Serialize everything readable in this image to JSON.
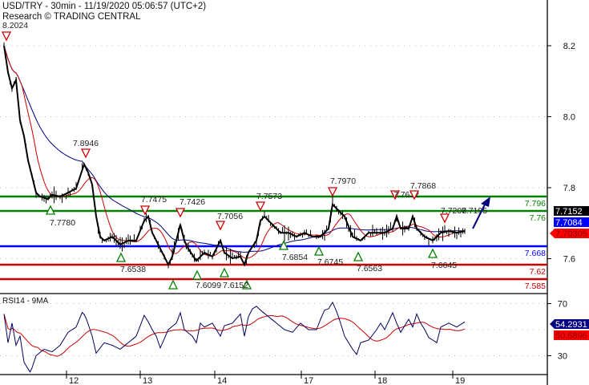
{
  "header": {
    "title": "USD/TRY - 30min - 11/19/2020 05:06:57 (UTC+2)",
    "subtitle": "Research © TRADING CENTRAL"
  },
  "rsi_panel": {
    "label": "RSI14 - 9MA"
  },
  "colors": {
    "price": "#000000",
    "ma_fast": "#cc0000",
    "ma_slow": "#000080",
    "resistance": "#008000",
    "pivot": "#0000ff",
    "support": "#cc0000",
    "rsi": "#000060",
    "rsi_ma": "#cc0000"
  },
  "chart_data": {
    "type": "line",
    "title": "USD/TRY - 30min",
    "y_ticks": [
      8.2,
      8.0,
      7.8,
      7.6
    ],
    "rsi_ticks": [
      70,
      30
    ],
    "rsi_range": [
      0,
      100
    ],
    "x_ticks": [
      {
        "label": "12",
        "t": 16.6
      },
      {
        "label": "13",
        "t": 35
      },
      {
        "label": "14",
        "t": 53.6
      },
      {
        "label": "17",
        "t": 75.2
      },
      {
        "label": "18",
        "t": 93.6
      },
      {
        "label": "19",
        "t": 113
      }
    ],
    "price": [
      [
        1,
        8.2
      ],
      [
        2,
        8.125
      ],
      [
        3,
        8.08
      ],
      [
        4,
        8.103
      ],
      [
        5,
        7.99
      ],
      [
        6,
        7.945
      ],
      [
        7,
        7.877
      ],
      [
        8,
        7.832
      ],
      [
        9,
        7.786
      ],
      [
        10,
        7.775
      ],
      [
        12,
        7.768
      ],
      [
        13,
        7.78
      ],
      [
        15,
        7.775
      ],
      [
        17,
        7.786
      ],
      [
        19,
        7.798
      ],
      [
        21,
        7.866
      ],
      [
        22,
        7.843
      ],
      [
        23,
        7.809
      ],
      [
        24,
        7.719
      ],
      [
        25,
        7.662
      ],
      [
        26,
        7.651
      ],
      [
        28,
        7.662
      ],
      [
        30,
        7.64
      ],
      [
        32,
        7.651
      ],
      [
        34,
        7.651
      ],
      [
        36,
        7.707
      ],
      [
        37,
        7.719
      ],
      [
        38,
        7.673
      ],
      [
        39,
        7.651
      ],
      [
        40,
        7.628
      ],
      [
        41,
        7.606
      ],
      [
        42,
        7.583
      ],
      [
        43,
        7.606
      ],
      [
        44,
        7.651
      ],
      [
        45,
        7.696
      ],
      [
        46,
        7.651
      ],
      [
        47,
        7.628
      ],
      [
        49,
        7.594
      ],
      [
        51,
        7.617
      ],
      [
        53,
        7.606
      ],
      [
        55,
        7.651
      ],
      [
        56,
        7.617
      ],
      [
        58,
        7.601
      ],
      [
        60,
        7.606
      ],
      [
        61,
        7.583
      ],
      [
        62,
        7.617
      ],
      [
        64,
        7.651
      ],
      [
        65,
        7.707
      ],
      [
        66,
        7.719
      ],
      [
        68,
        7.696
      ],
      [
        70,
        7.673
      ],
      [
        72,
        7.673
      ],
      [
        74,
        7.662
      ],
      [
        76,
        7.673
      ],
      [
        78,
        7.662
      ],
      [
        80,
        7.662
      ],
      [
        82,
        7.685
      ],
      [
        83,
        7.753
      ],
      [
        84,
        7.741
      ],
      [
        86,
        7.719
      ],
      [
        88,
        7.662
      ],
      [
        90,
        7.651
      ],
      [
        92,
        7.673
      ],
      [
        94,
        7.673
      ],
      [
        96,
        7.673
      ],
      [
        98,
        7.685
      ],
      [
        99,
        7.719
      ],
      [
        100,
        7.685
      ],
      [
        102,
        7.685
      ],
      [
        103,
        7.719
      ],
      [
        104,
        7.685
      ],
      [
        106,
        7.662
      ],
      [
        108,
        7.651
      ],
      [
        109,
        7.662
      ],
      [
        110,
        7.673
      ],
      [
        112,
        7.678
      ],
      [
        114,
        7.673
      ],
      [
        116,
        7.678
      ]
    ],
    "rsi": [
      [
        1,
        62
      ],
      [
        2,
        40
      ],
      [
        3,
        55
      ],
      [
        4,
        38
      ],
      [
        5,
        45
      ],
      [
        6,
        25
      ],
      [
        7,
        20
      ],
      [
        7.6,
        17
      ],
      [
        9,
        30
      ],
      [
        11,
        35
      ],
      [
        13,
        33
      ],
      [
        15,
        38
      ],
      [
        17,
        48
      ],
      [
        19,
        52
      ],
      [
        20.6,
        64
      ],
      [
        21.6,
        58
      ],
      [
        23,
        45
      ],
      [
        24,
        32
      ],
      [
        26,
        40
      ],
      [
        28,
        38
      ],
      [
        30,
        35
      ],
      [
        32,
        40
      ],
      [
        34,
        45
      ],
      [
        36,
        61
      ],
      [
        37,
        56
      ],
      [
        38,
        50
      ],
      [
        39,
        45
      ],
      [
        40,
        36
      ],
      [
        42,
        50
      ],
      [
        44,
        55
      ],
      [
        45,
        63
      ],
      [
        46,
        50
      ],
      [
        48,
        45
      ],
      [
        49,
        40
      ],
      [
        50,
        55
      ],
      [
        51,
        52
      ],
      [
        53,
        55
      ],
      [
        54,
        50
      ],
      [
        55,
        45
      ],
      [
        56,
        53
      ],
      [
        58,
        55
      ],
      [
        60,
        62
      ],
      [
        61,
        45
      ],
      [
        62,
        60
      ],
      [
        63,
        66
      ],
      [
        64,
        68
      ],
      [
        65,
        65
      ],
      [
        67,
        60
      ],
      [
        69,
        55
      ],
      [
        71,
        50
      ],
      [
        73,
        48
      ],
      [
        75,
        55
      ],
      [
        77,
        50
      ],
      [
        79,
        50
      ],
      [
        80,
        58
      ],
      [
        81,
        65
      ],
      [
        82,
        66
      ],
      [
        83,
        71
      ],
      [
        84,
        64
      ],
      [
        85,
        55
      ],
      [
        86,
        45
      ],
      [
        87,
        40
      ],
      [
        88,
        35
      ],
      [
        89,
        31
      ],
      [
        90,
        40
      ],
      [
        92,
        42
      ],
      [
        94,
        50
      ],
      [
        95,
        55
      ],
      [
        96,
        50
      ],
      [
        98,
        63
      ],
      [
        99,
        55
      ],
      [
        100,
        48
      ],
      [
        102,
        58
      ],
      [
        103,
        52
      ],
      [
        104,
        62
      ],
      [
        105,
        55
      ],
      [
        106,
        50
      ],
      [
        107,
        44
      ],
      [
        108,
        42
      ],
      [
        109,
        40
      ],
      [
        110,
        52
      ],
      [
        112,
        55
      ],
      [
        114,
        52
      ],
      [
        116,
        56
      ]
    ],
    "ma_fast_period": 5,
    "ma_slow_period": 20,
    "rsi_ma_period": 9
  },
  "levels": [
    {
      "value": "7.796",
      "kind": "resistance"
    },
    {
      "value": "7.76",
      "kind": "resistance"
    },
    {
      "value": "7.668",
      "kind": "pivot"
    },
    {
      "value": "7.62",
      "kind": "support"
    },
    {
      "value": "7.585",
      "kind": "support"
    }
  ],
  "annotations": [
    {
      "type": "down",
      "label": "8.2024"
    },
    {
      "type": "down",
      "label": "7.8946"
    },
    {
      "type": "up",
      "label": "7.7780"
    },
    {
      "type": "down",
      "label": "7.7475"
    },
    {
      "type": "up",
      "label": "7.6538"
    },
    {
      "type": "down",
      "label": "7.7426"
    },
    {
      "type": "up",
      "label": ""
    },
    {
      "type": "up",
      "label": "7.6099"
    },
    {
      "type": "up",
      "label": ""
    },
    {
      "type": "up",
      "label": "7.6152"
    },
    {
      "type": "down",
      "label": "7.7056"
    },
    {
      "type": "down",
      "label": "7.7573"
    },
    {
      "type": "up",
      "label": "7.6854"
    },
    {
      "type": "down",
      "label": "7.7970"
    },
    {
      "type": "up",
      "label": "7.6745"
    },
    {
      "type": "up",
      "label": "7.6563"
    },
    {
      "type": "down",
      "label": "7.7632"
    },
    {
      "type": "down",
      "label": "7.7868"
    },
    {
      "type": "down",
      "label": "7.7208"
    },
    {
      "type": "none",
      "label": "7.7195"
    },
    {
      "type": "up",
      "label": "7.6645"
    }
  ],
  "price_tags": [
    {
      "value": "7.7152",
      "bg": "#000000",
      "fg": "#ffffff"
    },
    {
      "value": "7.7084",
      "bg": "#0000ff",
      "fg": "#ffffff"
    },
    {
      "value": "7.70305",
      "bg": "#ff0000",
      "fg": "#800000"
    }
  ],
  "rsi_tags": [
    {
      "value": "54.2931",
      "bg": "#000080",
      "fg": "#ffffff"
    },
    {
      "value": "50.6896",
      "bg": "#ff0000",
      "fg": "#800000"
    }
  ]
}
